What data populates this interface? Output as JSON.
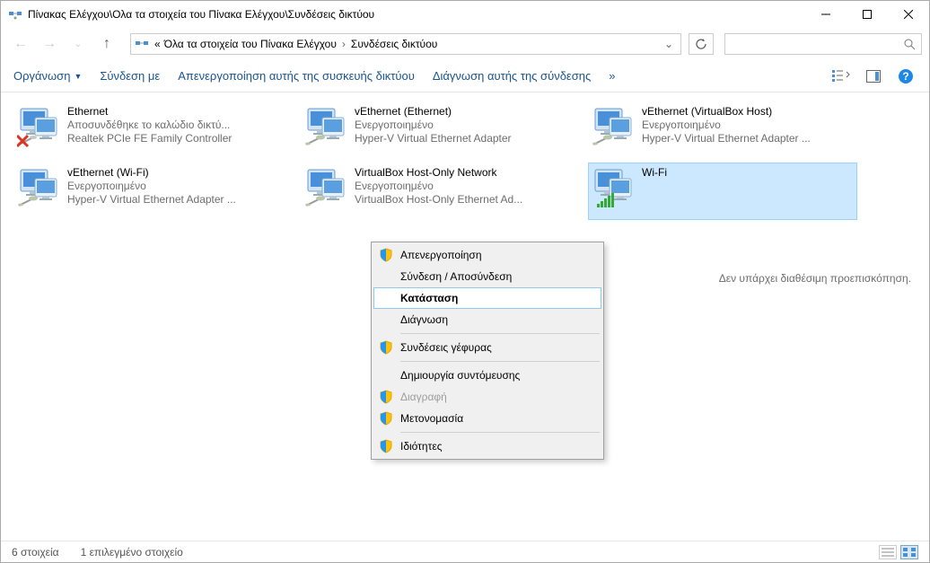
{
  "window": {
    "title": "Πίνακας Ελέγχου\\Ολα τα στοιχεία του Πίνακα Ελέγχου\\Συνδέσεις δικτύου"
  },
  "breadcrumb": {
    "prefix": "«",
    "part1": "Όλα τα στοιχεία του Πίνακα Ελέγχου",
    "part2": "Συνδέσεις δικτύου"
  },
  "toolbar": {
    "organize": "Οργάνωση",
    "connect_with": "Σύνδεση με",
    "disable": "Απενεργοποίηση αυτής της συσκευής δικτύου",
    "diagnose": "Διάγνωση αυτής της σύνδεσης",
    "overflow": "»"
  },
  "connections": [
    {
      "name": "Ethernet",
      "status": "Αποσυνδέθηκε το καλώδιο δικτύ...",
      "desc": "Realtek PCIe FE Family Controller",
      "type": "disconnected"
    },
    {
      "name": "vEthernet (Ethernet)",
      "status": "Ενεργοποιημένο",
      "desc": "Hyper-V Virtual Ethernet Adapter",
      "type": "cable"
    },
    {
      "name": "vEthernet (VirtualBox Host)",
      "status": "Ενεργοποιημένο",
      "desc": "Hyper-V Virtual Ethernet Adapter ...",
      "type": "cable"
    },
    {
      "name": "vEthernet (Wi-Fi)",
      "status": "Ενεργοποιημένο",
      "desc": "Hyper-V Virtual Ethernet Adapter ...",
      "type": "cable"
    },
    {
      "name": "VirtualBox Host-Only Network",
      "status": "Ενεργοποιημένο",
      "desc": "VirtualBox Host-Only Ethernet Ad...",
      "type": "cable"
    },
    {
      "name": "Wi-Fi",
      "status": "",
      "desc": "",
      "type": "wifi",
      "selected": true
    }
  ],
  "context_menu": {
    "items": [
      {
        "label": "Απενεργοποίηση",
        "shield": true
      },
      {
        "label": "Σύνδεση / Αποσύνδεση"
      },
      {
        "label": "Κατάσταση",
        "bold": true,
        "hovered": true
      },
      {
        "label": "Διάγνωση"
      },
      {
        "sep": true
      },
      {
        "label": "Συνδέσεις γέφυρας",
        "shield": true
      },
      {
        "sep": true
      },
      {
        "label": "Δημιουργία συντόμευσης"
      },
      {
        "label": "Διαγραφή",
        "shield": true,
        "disabled": true
      },
      {
        "label": "Μετονομασία",
        "shield": true
      },
      {
        "sep": true
      },
      {
        "label": "Ιδιότητες",
        "shield": true
      }
    ]
  },
  "preview": {
    "no_preview": "Δεν υπάρχει διαθέσιμη προεπισκόπηση."
  },
  "statusbar": {
    "count": "6 στοιχεία",
    "selected": "1 επιλεγμένο στοιχείο"
  }
}
